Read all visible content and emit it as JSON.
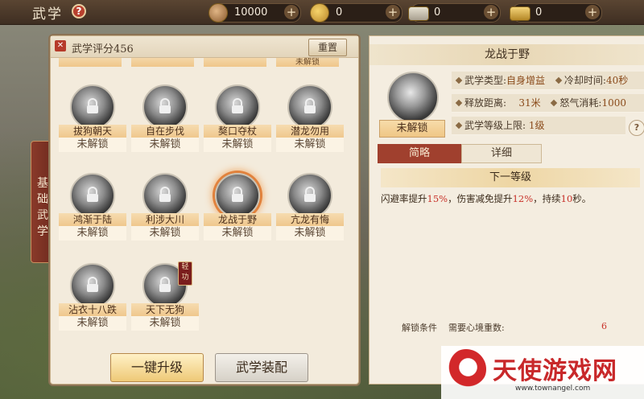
{
  "header": {
    "title": "武学",
    "help": "?",
    "resources": [
      {
        "icon": "copper-coin-icon",
        "value": "10000"
      },
      {
        "icon": "gold-coin-icon",
        "value": "0"
      },
      {
        "icon": "ingot-icon",
        "value": "0"
      },
      {
        "icon": "gold-ingot-icon",
        "value": "0"
      }
    ],
    "plus": "+"
  },
  "side_tab": "基础武学",
  "left_panel": {
    "score_label": "武学评分456",
    "reset_label": "重置",
    "scrolled_row_labels": [
      "",
      "",
      "",
      "未解锁"
    ],
    "skills": [
      {
        "name": "拔狗朝天",
        "state": "未解锁"
      },
      {
        "name": "自在步伐",
        "state": "未解锁"
      },
      {
        "name": "獒口夺杖",
        "state": "未解锁"
      },
      {
        "name": "潜龙勿用",
        "state": "未解锁"
      },
      {
        "name": "鸿渐于陆",
        "state": "未解锁"
      },
      {
        "name": "利涉大川",
        "state": "未解锁"
      },
      {
        "name": "龙战于野",
        "state": "未解锁"
      },
      {
        "name": "亢龙有悔",
        "state": "未解锁"
      },
      {
        "name": "沾衣十八跌",
        "state": "未解锁"
      },
      {
        "name": "天下无狗",
        "state": "未解锁",
        "badge": "轻功"
      }
    ],
    "btn_upgrade": "一键升级",
    "btn_equip": "武学装配"
  },
  "right_panel": {
    "title": "龙战于野",
    "lock_state": "未解锁",
    "info": {
      "type_label": "武学类型:",
      "type_value": "自身增益",
      "cooldown_label": "冷却时间:",
      "cooldown_value": "40秒",
      "range_label": "释放距离:",
      "range_value": "31米",
      "rage_label": "怒气消耗:",
      "rage_value": "1000",
      "level_label": "武学等级上限:",
      "level_value": "1级"
    },
    "help": "?",
    "tab_brief": "简略",
    "tab_detail": "详细",
    "next_level": "下一等级",
    "desc_parts": [
      "闪避率提升",
      "15%",
      "，伤害减免提升",
      "12%",
      "，持续",
      "10",
      "秒。"
    ],
    "unlock_label": "解锁条件",
    "unlock_req": "需要心境重数:",
    "unlock_value": "6"
  },
  "watermark": {
    "text": "天使游戏网",
    "url": "www.townangel.com"
  },
  "colors": {
    "accent_red": "#a0402e",
    "highlight_red": "#c8322a",
    "gold_button": "#eec977",
    "panel_bg": "#f4ede0"
  }
}
